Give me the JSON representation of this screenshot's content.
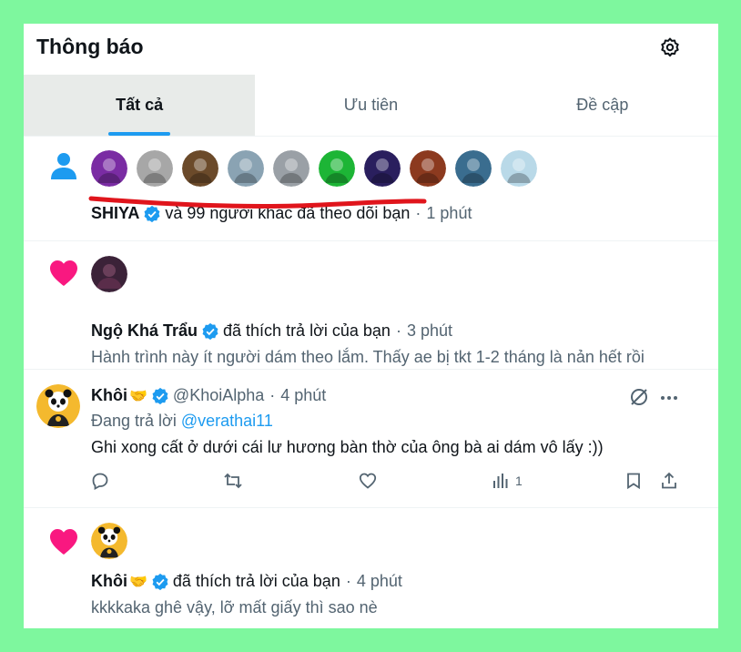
{
  "header": {
    "title": "Thông báo",
    "settings_icon": "gear-icon"
  },
  "tabs": [
    {
      "label": "Tất cả",
      "active": true
    },
    {
      "label": "Ưu tiên",
      "active": false
    },
    {
      "label": "Đề cập",
      "active": false
    }
  ],
  "follow_notification": {
    "icon": "person-icon",
    "avatar_colors": [
      "#7a2ca3",
      "#a7a7a7",
      "#6b4a2a",
      "#8aa3b3",
      "#9aa0a6",
      "#1db536",
      "#2a1f5e",
      "#8c3a1f",
      "#3a6d8f",
      "#b9d9e8"
    ],
    "name": "SHIYA",
    "text": "và 99 người khác đã theo dõi bạn",
    "sep": "·",
    "time": "1 phút"
  },
  "like_notification_1": {
    "icon": "heart-icon",
    "name": "Ngộ Khá Trẩu",
    "text": "đã thích trả lời của bạn",
    "sep": "·",
    "time": "3 phút",
    "content": "Hành trình này ít người dám theo lắm. Thấy ae bị tkt 1-2 tháng là nản hết rồi"
  },
  "reply_post": {
    "name": "Khôi",
    "name_emoji": "🤝",
    "handle": "@KhoiAlpha",
    "sep": "·",
    "time": "4 phút",
    "replying_prefix": "Đang trả lời",
    "replying_to": "@verathai11",
    "content": "Ghi xong cất ở dưới cái lư hương bàn thờ của ông bà ai dám vô lấy :))",
    "views": "1"
  },
  "like_notification_2": {
    "icon": "heart-icon",
    "name": "Khôi",
    "name_emoji": "🤝",
    "text": "đã thích trả lời của bạn",
    "sep": "·",
    "time": "4 phút",
    "content": "kkkkaka ghê vậy, lỡ mất giấy thì sao nè"
  },
  "colors": {
    "accent": "#1d9bf0",
    "heart": "#f91880",
    "underline": "#e0151c",
    "frame": "#7ef79e"
  }
}
